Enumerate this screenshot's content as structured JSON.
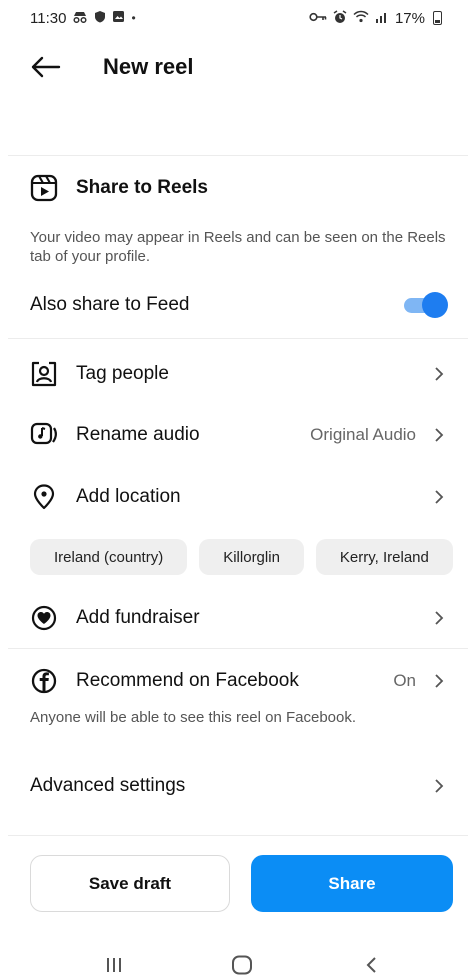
{
  "status_bar": {
    "time": "11:30",
    "battery": "17%",
    "left_icons": [
      "incognito-icon",
      "shield-icon",
      "image-icon",
      "dot-icon"
    ],
    "right_icons": [
      "key-icon",
      "alarm-icon",
      "wifi-icon",
      "signal-icon",
      "battery-icon"
    ]
  },
  "header": {
    "title": "New reel"
  },
  "share_reels": {
    "title": "Share to Reels",
    "description": "Your video may appear in Reels and can be seen on the Reels tab of your profile."
  },
  "feed_share": {
    "label": "Also share to Feed",
    "enabled": true
  },
  "rows": {
    "tag_people": "Tag people",
    "rename_audio": "Rename audio",
    "rename_audio_value": "Original Audio",
    "add_location": "Add location",
    "add_fundraiser": "Add fundraiser",
    "recommend_facebook": "Recommend on Facebook",
    "recommend_facebook_value": "On",
    "advanced_settings": "Advanced settings"
  },
  "location_suggestions": [
    "Ireland (country)",
    "Killorglin",
    "Kerry, Ireland"
  ],
  "facebook_note": "Anyone will be able to see this reel on Facebook.",
  "buttons": {
    "save_draft": "Save draft",
    "share": "Share"
  },
  "colors": {
    "accent": "#0b8df5",
    "toggle_track": "#7fb6f4",
    "toggle_knob": "#1e7df0",
    "chip_bg": "#efefef"
  }
}
